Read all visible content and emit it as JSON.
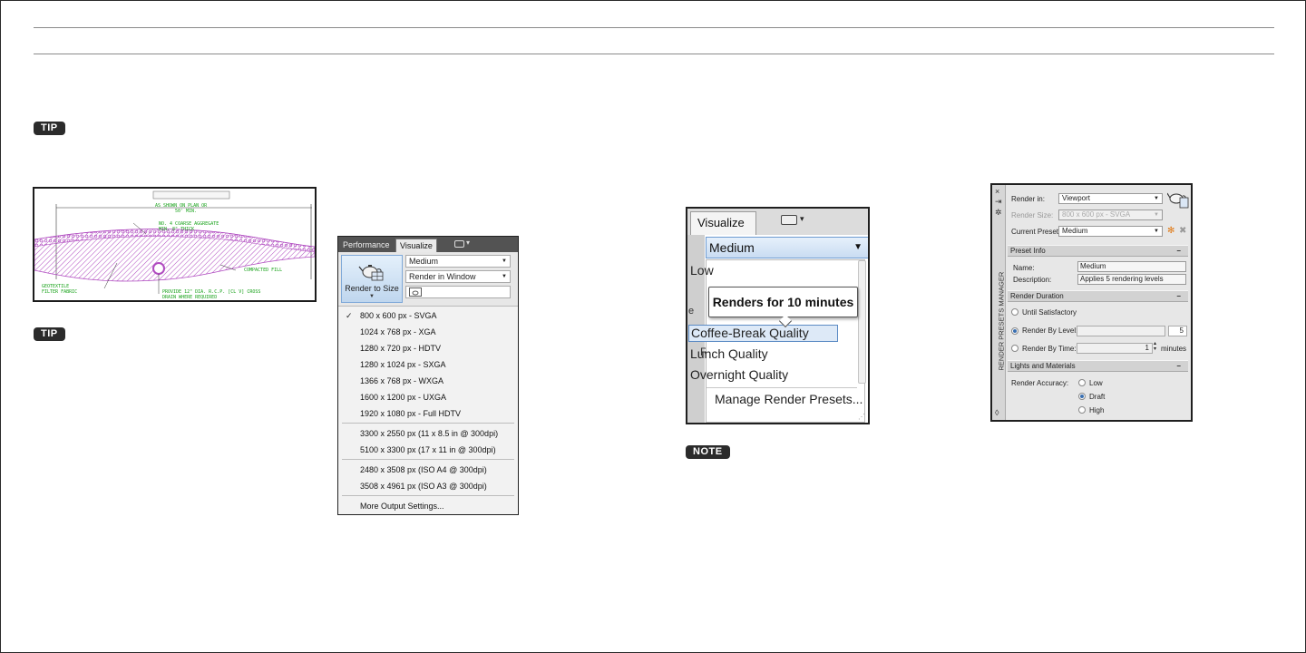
{
  "page": {
    "tip_badge_1": "TIP",
    "tip_badge_2": "TIP",
    "note_badge": "NOTE"
  },
  "drawing": {
    "labels": {
      "plan": "AS SHOWN ON PLAN OR",
      "min": "50' MIN.",
      "aggregate_1": "NO. 4  COARSE AGGREGATE",
      "aggregate_2": "MIN. 8\" THICK",
      "fill": "COMPACTED FILL",
      "fabric_1": "GEOTEXTILE",
      "fabric_2": "FILTER FABRIC",
      "drain_1": "PROVIDE 12\" DIA. R.C.P. [CL V] CROSS",
      "drain_2": "DRAIN WHERE REQUIRED"
    },
    "colors": {
      "hatch": "#b04bc0",
      "text": "#18a21a",
      "line": "#333333"
    }
  },
  "render_to_size": {
    "tabs": [
      "Performance",
      "Visualize"
    ],
    "active_tab": "Visualize",
    "button_label": "Render to Size",
    "preset_value": "Medium",
    "render_location_value": "Render in Window",
    "menu_checked": "800 x 600 px - SVGA",
    "menu_group_1": [
      "800 x 600 px - SVGA",
      "1024 x 768 px - XGA",
      "1280 x 720 px - HDTV",
      "1280 x 1024 px - SXGA",
      "1366 x 768 px - WXGA",
      "1600 x 1200 px - UXGA",
      "1920 x 1080 px - Full HDTV"
    ],
    "menu_group_2": [
      "3300 x 2550 px (11 x 8.5 in @ 300dpi)",
      "5100 x 3300 px (17 x 11 in @ 300dpi)"
    ],
    "menu_group_3": [
      "2480 x 3508 px (ISO A4 @ 300dpi)",
      "3508 x 4961 px (ISO A3 @ 300dpi)"
    ],
    "more": "More Output Settings..."
  },
  "visualize_dropdown": {
    "tab": "Visualize",
    "selected": "Medium",
    "options": [
      "Low",
      "Coffee-Break Quality",
      "Lunch Quality",
      "Overnight Quality"
    ],
    "highlighted": "Coffee-Break Quality",
    "manage": "Manage Render Presets...",
    "tooltip": "Renders for 10 minutes",
    "ghost_e": "e",
    "ghost_r": "R"
  },
  "render_presets_manager": {
    "title": "RENDER PRESETS MANAGER",
    "render_in_label": "Render in:",
    "render_in_value": "Viewport",
    "render_size_label": "Render Size:",
    "render_size_value": "800 x 600 px - SVGA",
    "current_preset_label": "Current Preset:",
    "current_preset_value": "Medium",
    "sections": {
      "preset_info": "Preset Info",
      "render_duration": "Render Duration",
      "lights_materials": "Lights and Materials"
    },
    "name_label": "Name:",
    "name_value": "Medium",
    "description_label": "Description:",
    "description_value": "Applies 5 rendering levels",
    "until_satisfactory": "Until Satisfactory",
    "render_by_level": "Render By Level:",
    "level_value": "5",
    "render_by_time": "Render By Time:",
    "time_value": "1",
    "minutes": "minutes",
    "accuracy_label": "Render Accuracy:",
    "accuracy_options": [
      "Low",
      "Draft",
      "High"
    ],
    "accuracy_selected": "Draft",
    "duration_selected": "Render By Level:",
    "collapse_glyph": "–"
  }
}
